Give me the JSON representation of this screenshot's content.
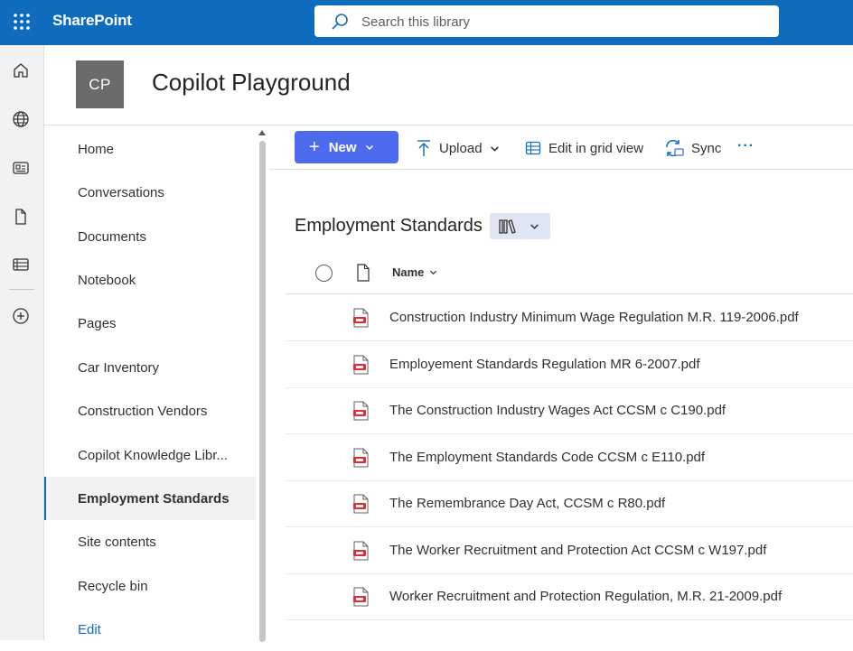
{
  "app": {
    "brand": "SharePoint",
    "accent": "#0f6cbd",
    "icons": {
      "app_launcher": "waffle-icon"
    }
  },
  "search": {
    "placeholder": "Search this library",
    "icon": "search-icon"
  },
  "rail": {
    "icons": [
      "home-icon",
      "globe-icon",
      "news-icon",
      "file-icon",
      "list-icon",
      "add-circle-icon"
    ]
  },
  "site": {
    "logo_initials": "CP",
    "title": "Copilot Playground"
  },
  "nav": {
    "items": [
      {
        "label": "Home"
      },
      {
        "label": "Conversations"
      },
      {
        "label": "Documents"
      },
      {
        "label": "Notebook"
      },
      {
        "label": "Pages"
      },
      {
        "label": "Car Inventory"
      },
      {
        "label": "Construction Vendors"
      },
      {
        "label": "Copilot Knowledge Libr..."
      },
      {
        "label": "Employment Standards",
        "selected": true
      },
      {
        "label": "Site contents"
      },
      {
        "label": "Recycle bin"
      }
    ],
    "edit_label": "Edit"
  },
  "commands": {
    "new_label": "New",
    "upload_label": "Upload",
    "grid_label": "Edit in grid view",
    "sync_label": "Sync",
    "more_label": "···",
    "new_color": "#4f6bed"
  },
  "library": {
    "title": "Employment Standards",
    "columns": {
      "name": "Name"
    },
    "files": [
      {
        "name": "Construction Industry Minimum Wage Regulation M.R. 119-2006.pdf"
      },
      {
        "name": "Employement Standards Regulation MR 6-2007.pdf"
      },
      {
        "name": "The Construction Industry Wages Act CCSM c C190.pdf"
      },
      {
        "name": "The Employment Standards Code CCSM c E110.pdf"
      },
      {
        "name": "The Remembrance Day Act, CCSM c R80.pdf"
      },
      {
        "name": "The Worker Recruitment and Protection Act CCSM c W197.pdf"
      },
      {
        "name": "Worker Recruitment and Protection Regulation, M.R. 21-2009.pdf"
      }
    ]
  }
}
